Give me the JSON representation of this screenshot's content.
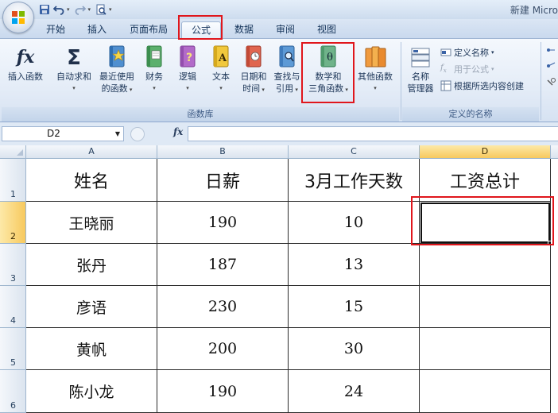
{
  "titlebar": {
    "title": "新建 Micro",
    "qat": {
      "save_icon": "save-icon",
      "undo_icon": "undo-icon",
      "redo_icon": "redo-icon",
      "preview_icon": "print-preview-icon",
      "customize_icon": "customize-qat-icon"
    }
  },
  "tabs": [
    "开始",
    "插入",
    "页面布局",
    "公式",
    "数据",
    "审阅",
    "视图"
  ],
  "active_tab": "公式",
  "ribbon": {
    "function_library": {
      "label": "函数库",
      "buttons": {
        "insert_function": "插入函数",
        "autosum": "自动求和",
        "recent_line1": "最近使用",
        "recent_line2": "的函数",
        "financial": "财务",
        "logical": "逻辑",
        "text": "文本",
        "datetime_line1": "日期和",
        "datetime_line2": "时间",
        "lookup_line1": "查找与",
        "lookup_line2": "引用",
        "math_line1": "数学和",
        "math_line2": "三角函数",
        "more": "其他函数"
      }
    },
    "defined_names": {
      "label": "定义的名称",
      "name_manager_line1": "名称",
      "name_manager_line2": "管理器",
      "define_name": "定义名称",
      "use_in_formula": "用于公式",
      "create_from_selection": "根据所选内容创建"
    }
  },
  "formula_bar": {
    "name_box": "D2",
    "fx": "fx",
    "value": ""
  },
  "sheet": {
    "columns": [
      "A",
      "B",
      "C",
      "D"
    ],
    "rows": [
      "1",
      "2",
      "3",
      "4",
      "5",
      "6"
    ],
    "selected_cell": "D2",
    "header_row": [
      "姓名",
      "日薪",
      "3月工作天数",
      "工资总计"
    ],
    "data": [
      [
        "王晓丽",
        "190",
        "10",
        ""
      ],
      [
        "张丹",
        "187",
        "13",
        ""
      ],
      [
        "彦语",
        "230",
        "15",
        ""
      ],
      [
        "黄帆",
        "200",
        "30",
        ""
      ],
      [
        "陈小龙",
        "190",
        "24",
        ""
      ]
    ]
  },
  "colors": {
    "highlight": "#e0161c",
    "selected_header": "#f7c95e",
    "ribbon_bg": "#e4ecf7"
  }
}
